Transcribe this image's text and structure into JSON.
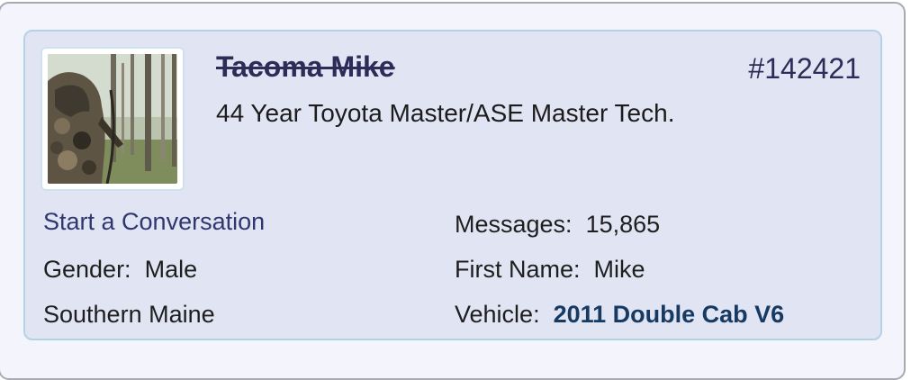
{
  "profile": {
    "username": "Tacoma Mike",
    "user_id": "#142421",
    "user_title": "44 Year Toyota Master/ASE Master Tech.",
    "start_conversation": "Start a Conversation",
    "gender_label": "Gender:",
    "gender_value": "Male",
    "location": "Southern Maine",
    "messages_label": "Messages:",
    "messages_value": "15,865",
    "first_name_label": "First Name:",
    "first_name_value": "Mike",
    "vehicle_label": "Vehicle:",
    "vehicle_value": "2011 Double Cab V6"
  },
  "colors": {
    "card_background": "#e1e4f3",
    "card_border": "#b4d2e6",
    "username_color": "#2b2d58",
    "vehicle_color": "#173a63"
  },
  "icons": {
    "avatar": "camouflage-hunter-in-forest-photo"
  }
}
